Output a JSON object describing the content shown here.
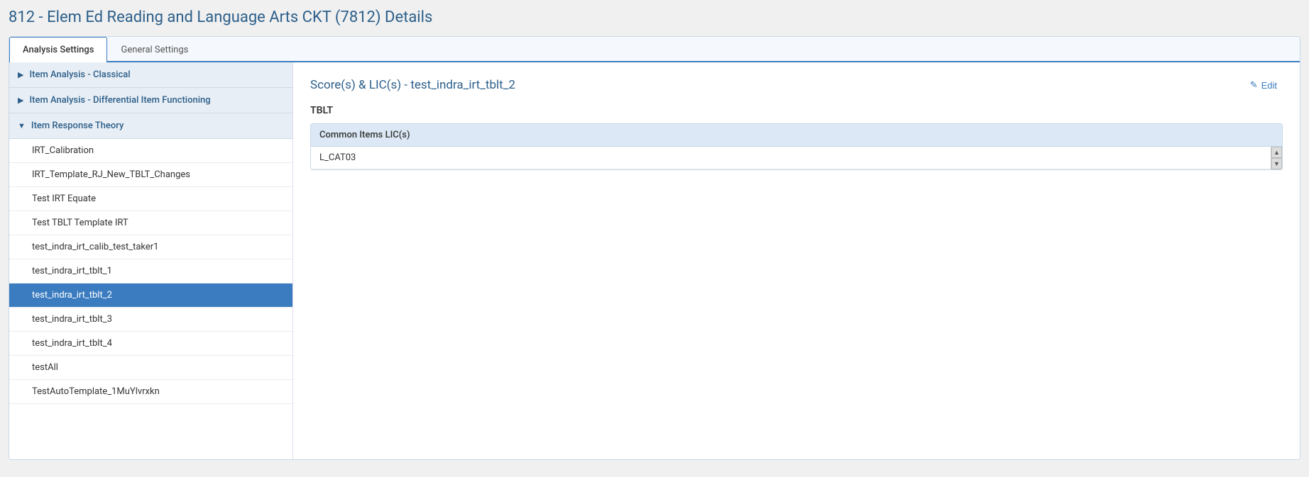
{
  "page": {
    "title": "812 - Elem Ed Reading and Language Arts CKT (7812) Details"
  },
  "tabs": [
    {
      "id": "analysis",
      "label": "Analysis Settings",
      "active": true
    },
    {
      "id": "general",
      "label": "General Settings",
      "active": false
    }
  ],
  "left_panel": {
    "sections": [
      {
        "id": "item-analysis-classical",
        "label": "Item Analysis - Classical",
        "expanded": false,
        "chevron": "▶",
        "items": []
      },
      {
        "id": "item-analysis-dif",
        "label": "Item Analysis - Differential Item Functioning",
        "expanded": false,
        "chevron": "▶",
        "items": []
      },
      {
        "id": "item-response-theory",
        "label": "Item Response Theory",
        "expanded": true,
        "chevron": "▼",
        "items": [
          {
            "id": "irt-calibration",
            "label": "IRT_Calibration",
            "selected": false
          },
          {
            "id": "irt-template",
            "label": "IRT_Template_RJ_New_TBLT_Changes",
            "selected": false
          },
          {
            "id": "test-irt-equate",
            "label": "Test IRT Equate",
            "selected": false
          },
          {
            "id": "test-tblt-template-irt",
            "label": "Test TBLT Template IRT",
            "selected": false
          },
          {
            "id": "test-indra-calib",
            "label": "test_indra_irt_calib_test_taker1",
            "selected": false
          },
          {
            "id": "test-indra-tblt-1",
            "label": "test_indra_irt_tblt_1",
            "selected": false
          },
          {
            "id": "test-indra-tblt-2",
            "label": "test_indra_irt_tblt_2",
            "selected": true
          },
          {
            "id": "test-indra-tblt-3",
            "label": "test_indra_irt_tblt_3",
            "selected": false
          },
          {
            "id": "test-indra-tblt-4",
            "label": "test_indra_irt_tblt_4",
            "selected": false
          },
          {
            "id": "test-all",
            "label": "testAll",
            "selected": false
          },
          {
            "id": "test-auto-template",
            "label": "TestAutoTemplate_1MuYlvrxkn",
            "selected": false
          }
        ]
      }
    ]
  },
  "right_panel": {
    "title": "Score(s) & LIC(s) - test_indra_irt_tblt_2",
    "edit_label": "Edit",
    "section_label": "TBLT",
    "lic_table": {
      "header": "Common Items LIC(s)",
      "rows": [
        {
          "value": "L_CAT03"
        }
      ]
    }
  }
}
